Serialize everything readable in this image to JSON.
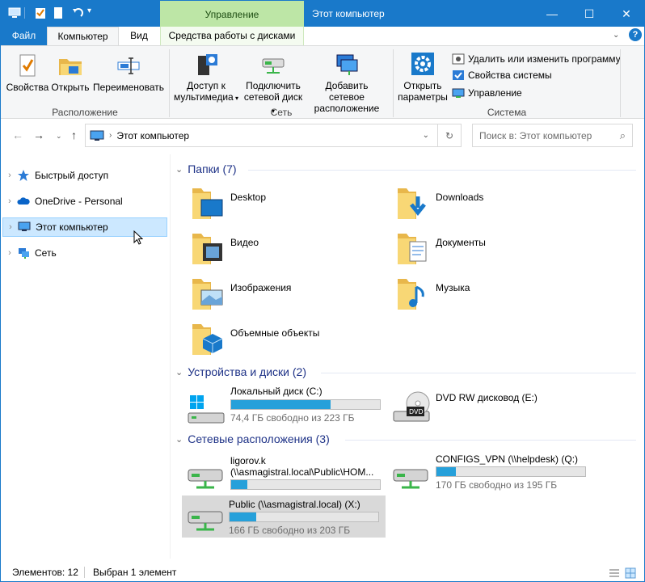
{
  "titlebar": {
    "context_tab": "Управление",
    "window_title": "Этот компьютер",
    "minimize": "—",
    "maximize": "☐",
    "close": "✕"
  },
  "tabs": {
    "file": "Файл",
    "computer": "Компьютер",
    "view": "Вид",
    "drive_tools": "Средства работы с дисками"
  },
  "ribbon": {
    "location": {
      "group": "Расположение",
      "properties": "Свойства",
      "open": "Открыть",
      "rename": "Переименовать"
    },
    "network": {
      "group": "Сеть",
      "media_line1": "Доступ к",
      "media_line2": "мультимедиа",
      "map_line1": "Подключить",
      "map_line2": "сетевой диск",
      "add_line1": "Добавить сетевое",
      "add_line2": "расположение"
    },
    "system": {
      "group": "Система",
      "settings_line1": "Открыть",
      "settings_line2": "параметры",
      "uninstall": "Удалить или изменить программу",
      "system_props": "Свойства системы",
      "manage": "Управление"
    }
  },
  "address": {
    "path": "Этот компьютер",
    "search_placeholder": "Поиск в: Этот компьютер"
  },
  "navpane": {
    "items": [
      {
        "label": "Быстрый доступ"
      },
      {
        "label": "OneDrive - Personal"
      },
      {
        "label": "Этот компьютер"
      },
      {
        "label": "Сеть"
      }
    ]
  },
  "groups": {
    "folders": "Папки (7)",
    "devices": "Устройства и диски (2)",
    "network": "Сетевые расположения (3)"
  },
  "folders": [
    {
      "label": "Desktop",
      "icon": "desktop-folder-icon"
    },
    {
      "label": "Downloads",
      "icon": "downloads-folder-icon"
    },
    {
      "label": "Видео",
      "icon": "videos-folder-icon"
    },
    {
      "label": "Документы",
      "icon": "documents-folder-icon"
    },
    {
      "label": "Изображения",
      "icon": "pictures-folder-icon"
    },
    {
      "label": "Музыка",
      "icon": "music-folder-icon"
    },
    {
      "label": "Объемные объекты",
      "icon": "3d-objects-folder-icon"
    }
  ],
  "drives": [
    {
      "label": "Локальный диск (C:)",
      "free": "74,4 ГБ свободно из 223 ГБ",
      "used_fraction": 0.67
    },
    {
      "label": "DVD RW дисковод (E:)"
    }
  ],
  "network_drives": [
    {
      "label_line1": "ligorov.k",
      "label_line2": "(\\\\asmagistral.local\\Public\\HOM...",
      "used_fraction": 0.11
    },
    {
      "label": "CONFIGS_VPN (\\\\helpdesk) (Q:)",
      "free": "170 ГБ свободно из 195 ГБ",
      "used_fraction": 0.13
    },
    {
      "label": "Public (\\\\asmagistral.local) (X:)",
      "free": "166 ГБ свободно из 203 ГБ",
      "used_fraction": 0.18
    }
  ],
  "status": {
    "count": "Элементов: 12",
    "selected": "Выбран 1 элемент"
  },
  "colors": {
    "accent": "#1979ca",
    "context_green": "#bde6a6",
    "selection": "#cce8ff",
    "bar_fill": "#26a0da"
  }
}
